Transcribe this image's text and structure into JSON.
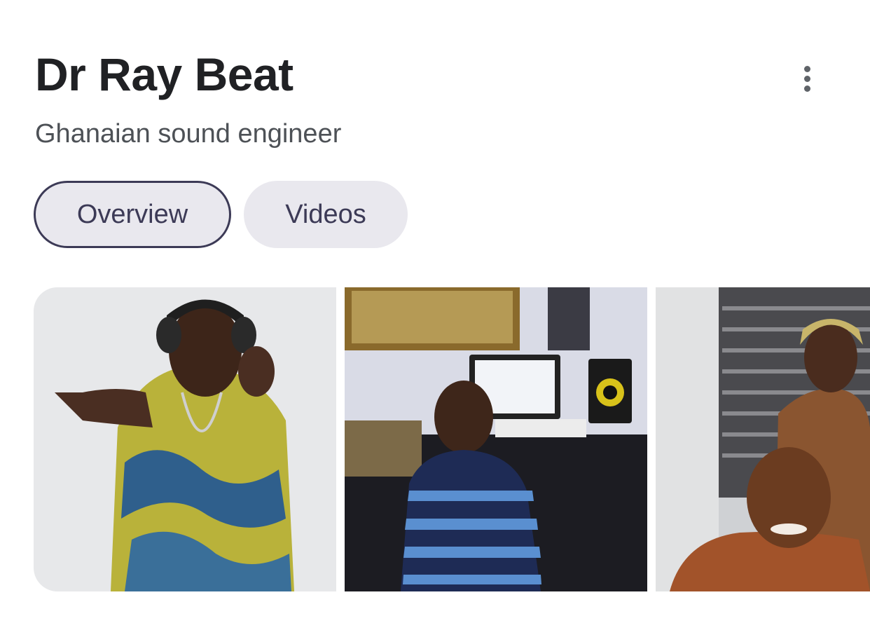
{
  "entity": {
    "title": "Dr Ray Beat",
    "subtitle": "Ghanaian sound engineer"
  },
  "more_menu": {
    "icon": "more-vert-icon"
  },
  "tabs": [
    {
      "label": "Overview",
      "selected": true
    },
    {
      "label": "Videos",
      "selected": false
    }
  ],
  "colors": {
    "title": "#202124",
    "subtitle": "#4d5156",
    "chip_bg": "#e9e8ee",
    "chip_text": "#3c3a56"
  }
}
